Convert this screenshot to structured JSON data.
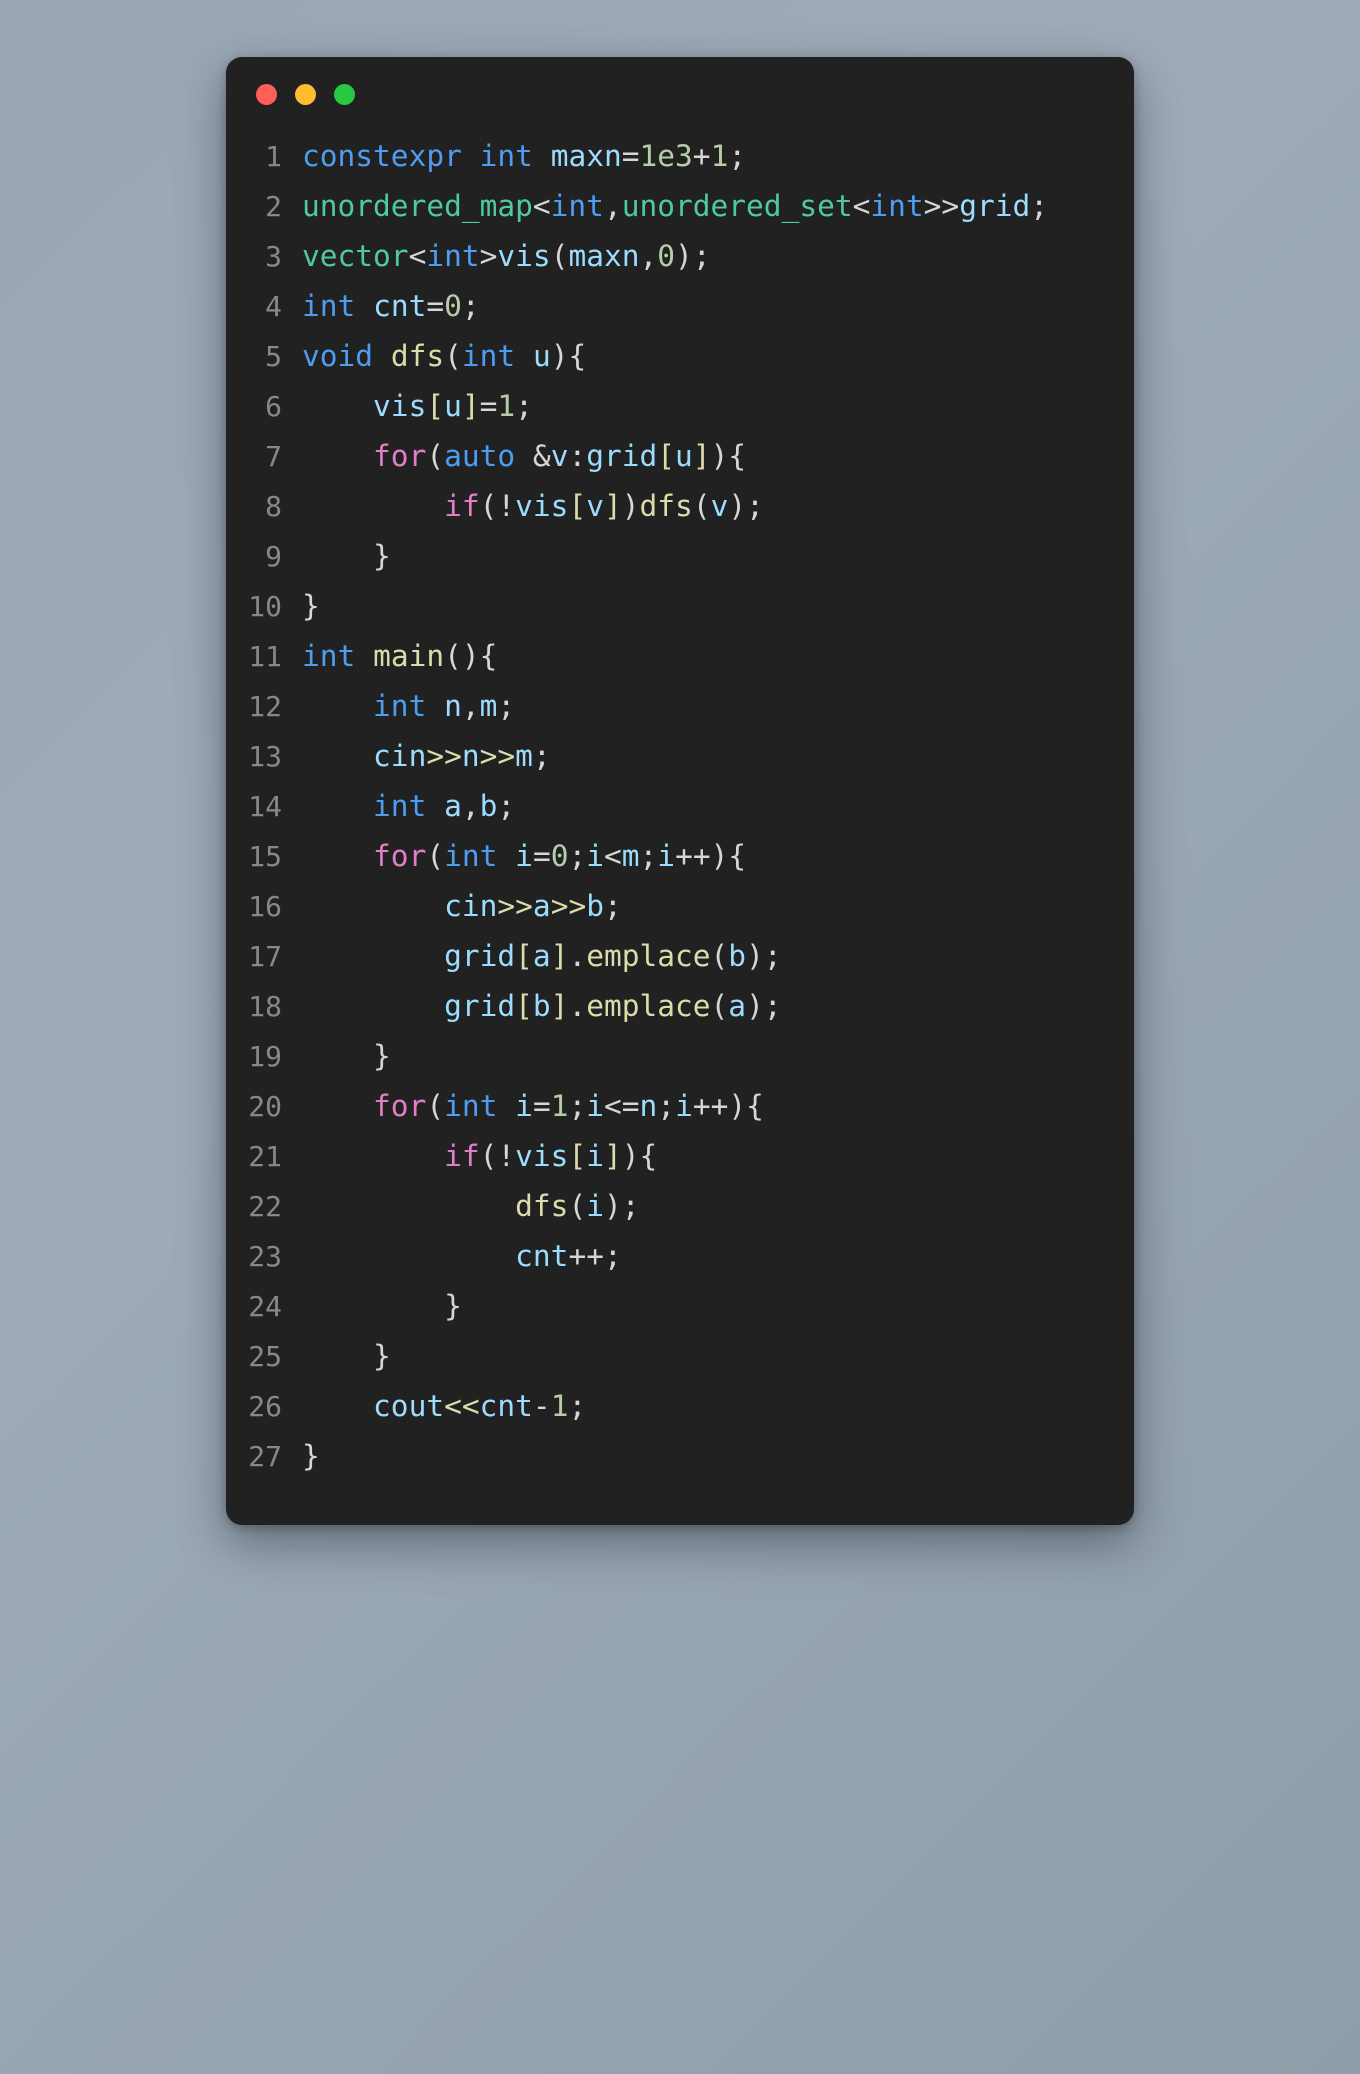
{
  "window": {
    "traffic_lights": [
      {
        "name": "close-button",
        "color": "#ff5f57"
      },
      {
        "name": "minimize-button",
        "color": "#febc2e"
      },
      {
        "name": "maximize-button",
        "color": "#28c840"
      }
    ],
    "background": "#212121",
    "page_background": "#99a5b3"
  },
  "editor": {
    "language": "cpp",
    "line_count": 27,
    "plain_code": "constexpr int maxn=1e3+1;\nunordered_map<int,unordered_set<int>>grid;\nvector<int>vis(maxn,0);\nint cnt=0;\nvoid dfs(int u){\n    vis[u]=1;\n    for(auto &v:grid[u]){\n        if(!vis[v])dfs(v);\n    }\n}\nint main(){\n    int n,m;\n    cin>>n>>m;\n    int a,b;\n    for(int i=0;i<m;i++){\n        cin>>a>>b;\n        grid[a].emplace(b);\n        grid[b].emplace(a);\n    }\n    for(int i=1;i<=n;i++){\n        if(!vis[i]){\n            dfs(i);\n            cnt++;\n        }\n    }\n    cout<<cnt-1;\n}",
    "theme_colors": {
      "keyword": "#4d9df0",
      "control": "#e07ec8",
      "type": "#4ec9a0",
      "variable": "#9cdcfe",
      "function": "#dcdcaa",
      "bracket": "#dcdcaa",
      "number": "#b5cea8",
      "operator": "#d6d6d6",
      "line_number": "#888888"
    },
    "lines": [
      {
        "n": "1",
        "tokens": [
          {
            "t": "constexpr",
            "c": "kw"
          },
          {
            "t": " ",
            "c": "op"
          },
          {
            "t": "int",
            "c": "kw"
          },
          {
            "t": " ",
            "c": "op"
          },
          {
            "t": "maxn",
            "c": "var"
          },
          {
            "t": "=",
            "c": "op"
          },
          {
            "t": "1e3",
            "c": "num"
          },
          {
            "t": "+",
            "c": "op"
          },
          {
            "t": "1",
            "c": "num"
          },
          {
            "t": ";",
            "c": "op"
          }
        ]
      },
      {
        "n": "2",
        "tokens": [
          {
            "t": "unordered_map",
            "c": "type"
          },
          {
            "t": "<",
            "c": "op"
          },
          {
            "t": "int",
            "c": "kw"
          },
          {
            "t": ",",
            "c": "op"
          },
          {
            "t": "unordered_set",
            "c": "type"
          },
          {
            "t": "<",
            "c": "op"
          },
          {
            "t": "int",
            "c": "kw"
          },
          {
            "t": ">>",
            "c": "op"
          },
          {
            "t": "grid",
            "c": "var"
          },
          {
            "t": ";",
            "c": "op"
          }
        ]
      },
      {
        "n": "3",
        "tokens": [
          {
            "t": "vector",
            "c": "type"
          },
          {
            "t": "<",
            "c": "op"
          },
          {
            "t": "int",
            "c": "kw"
          },
          {
            "t": ">",
            "c": "op"
          },
          {
            "t": "vis",
            "c": "var"
          },
          {
            "t": "(",
            "c": "op"
          },
          {
            "t": "maxn",
            "c": "var"
          },
          {
            "t": ",",
            "c": "op"
          },
          {
            "t": "0",
            "c": "num"
          },
          {
            "t": ")",
            "c": "op"
          },
          {
            "t": ";",
            "c": "op"
          }
        ]
      },
      {
        "n": "4",
        "tokens": [
          {
            "t": "int",
            "c": "kw"
          },
          {
            "t": " ",
            "c": "op"
          },
          {
            "t": "cnt",
            "c": "var"
          },
          {
            "t": "=",
            "c": "op"
          },
          {
            "t": "0",
            "c": "num"
          },
          {
            "t": ";",
            "c": "op"
          }
        ]
      },
      {
        "n": "5",
        "tokens": [
          {
            "t": "void",
            "c": "kw"
          },
          {
            "t": " ",
            "c": "op"
          },
          {
            "t": "dfs",
            "c": "fn"
          },
          {
            "t": "(",
            "c": "op"
          },
          {
            "t": "int",
            "c": "kw"
          },
          {
            "t": " ",
            "c": "op"
          },
          {
            "t": "u",
            "c": "var"
          },
          {
            "t": "){",
            "c": "op"
          }
        ]
      },
      {
        "n": "6",
        "tokens": [
          {
            "t": "    ",
            "c": "op"
          },
          {
            "t": "vis",
            "c": "var"
          },
          {
            "t": "[",
            "c": "br"
          },
          {
            "t": "u",
            "c": "var"
          },
          {
            "t": "]",
            "c": "br"
          },
          {
            "t": "=",
            "c": "op"
          },
          {
            "t": "1",
            "c": "num"
          },
          {
            "t": ";",
            "c": "op"
          }
        ]
      },
      {
        "n": "7",
        "tokens": [
          {
            "t": "    ",
            "c": "op"
          },
          {
            "t": "for",
            "c": "ctl"
          },
          {
            "t": "(",
            "c": "op"
          },
          {
            "t": "auto",
            "c": "kw"
          },
          {
            "t": " &",
            "c": "op"
          },
          {
            "t": "v",
            "c": "var"
          },
          {
            "t": ":",
            "c": "op"
          },
          {
            "t": "grid",
            "c": "var"
          },
          {
            "t": "[",
            "c": "br"
          },
          {
            "t": "u",
            "c": "var"
          },
          {
            "t": "]",
            "c": "br"
          },
          {
            "t": "){",
            "c": "op"
          }
        ]
      },
      {
        "n": "8",
        "tokens": [
          {
            "t": "        ",
            "c": "op"
          },
          {
            "t": "if",
            "c": "ctl"
          },
          {
            "t": "(!",
            "c": "op"
          },
          {
            "t": "vis",
            "c": "var"
          },
          {
            "t": "[",
            "c": "br"
          },
          {
            "t": "v",
            "c": "var"
          },
          {
            "t": "]",
            "c": "br"
          },
          {
            "t": ")",
            "c": "op"
          },
          {
            "t": "dfs",
            "c": "fn"
          },
          {
            "t": "(",
            "c": "op"
          },
          {
            "t": "v",
            "c": "var"
          },
          {
            "t": ");",
            "c": "op"
          }
        ]
      },
      {
        "n": "9",
        "tokens": [
          {
            "t": "    }",
            "c": "op"
          }
        ]
      },
      {
        "n": "10",
        "tokens": [
          {
            "t": "}",
            "c": "op"
          }
        ]
      },
      {
        "n": "11",
        "tokens": [
          {
            "t": "int",
            "c": "kw"
          },
          {
            "t": " ",
            "c": "op"
          },
          {
            "t": "main",
            "c": "fn"
          },
          {
            "t": "(){",
            "c": "op"
          }
        ]
      },
      {
        "n": "12",
        "tokens": [
          {
            "t": "    ",
            "c": "op"
          },
          {
            "t": "int",
            "c": "kw"
          },
          {
            "t": " ",
            "c": "op"
          },
          {
            "t": "n",
            "c": "var"
          },
          {
            "t": ",",
            "c": "op"
          },
          {
            "t": "m",
            "c": "var"
          },
          {
            "t": ";",
            "c": "op"
          }
        ]
      },
      {
        "n": "13",
        "tokens": [
          {
            "t": "    ",
            "c": "op"
          },
          {
            "t": "cin",
            "c": "var"
          },
          {
            "t": ">>",
            "c": "br"
          },
          {
            "t": "n",
            "c": "var"
          },
          {
            "t": ">>",
            "c": "br"
          },
          {
            "t": "m",
            "c": "var"
          },
          {
            "t": ";",
            "c": "op"
          }
        ]
      },
      {
        "n": "14",
        "tokens": [
          {
            "t": "    ",
            "c": "op"
          },
          {
            "t": "int",
            "c": "kw"
          },
          {
            "t": " ",
            "c": "op"
          },
          {
            "t": "a",
            "c": "var"
          },
          {
            "t": ",",
            "c": "op"
          },
          {
            "t": "b",
            "c": "var"
          },
          {
            "t": ";",
            "c": "op"
          }
        ]
      },
      {
        "n": "15",
        "tokens": [
          {
            "t": "    ",
            "c": "op"
          },
          {
            "t": "for",
            "c": "ctl"
          },
          {
            "t": "(",
            "c": "op"
          },
          {
            "t": "int",
            "c": "kw"
          },
          {
            "t": " ",
            "c": "op"
          },
          {
            "t": "i",
            "c": "var"
          },
          {
            "t": "=",
            "c": "op"
          },
          {
            "t": "0",
            "c": "num"
          },
          {
            "t": ";",
            "c": "op"
          },
          {
            "t": "i",
            "c": "var"
          },
          {
            "t": "<",
            "c": "op"
          },
          {
            "t": "m",
            "c": "var"
          },
          {
            "t": ";",
            "c": "op"
          },
          {
            "t": "i",
            "c": "var"
          },
          {
            "t": "++){",
            "c": "op"
          }
        ]
      },
      {
        "n": "16",
        "tokens": [
          {
            "t": "        ",
            "c": "op"
          },
          {
            "t": "cin",
            "c": "var"
          },
          {
            "t": ">>",
            "c": "br"
          },
          {
            "t": "a",
            "c": "var"
          },
          {
            "t": ">>",
            "c": "br"
          },
          {
            "t": "b",
            "c": "var"
          },
          {
            "t": ";",
            "c": "op"
          }
        ]
      },
      {
        "n": "17",
        "tokens": [
          {
            "t": "        ",
            "c": "op"
          },
          {
            "t": "grid",
            "c": "var"
          },
          {
            "t": "[",
            "c": "br"
          },
          {
            "t": "a",
            "c": "var"
          },
          {
            "t": "]",
            "c": "br"
          },
          {
            "t": ".",
            "c": "op"
          },
          {
            "t": "emplace",
            "c": "fn"
          },
          {
            "t": "(",
            "c": "op"
          },
          {
            "t": "b",
            "c": "var"
          },
          {
            "t": ");",
            "c": "op"
          }
        ]
      },
      {
        "n": "18",
        "tokens": [
          {
            "t": "        ",
            "c": "op"
          },
          {
            "t": "grid",
            "c": "var"
          },
          {
            "t": "[",
            "c": "br"
          },
          {
            "t": "b",
            "c": "var"
          },
          {
            "t": "]",
            "c": "br"
          },
          {
            "t": ".",
            "c": "op"
          },
          {
            "t": "emplace",
            "c": "fn"
          },
          {
            "t": "(",
            "c": "op"
          },
          {
            "t": "a",
            "c": "var"
          },
          {
            "t": ");",
            "c": "op"
          }
        ]
      },
      {
        "n": "19",
        "tokens": [
          {
            "t": "    }",
            "c": "op"
          }
        ]
      },
      {
        "n": "20",
        "tokens": [
          {
            "t": "    ",
            "c": "op"
          },
          {
            "t": "for",
            "c": "ctl"
          },
          {
            "t": "(",
            "c": "op"
          },
          {
            "t": "int",
            "c": "kw"
          },
          {
            "t": " ",
            "c": "op"
          },
          {
            "t": "i",
            "c": "var"
          },
          {
            "t": "=",
            "c": "op"
          },
          {
            "t": "1",
            "c": "num"
          },
          {
            "t": ";",
            "c": "op"
          },
          {
            "t": "i",
            "c": "var"
          },
          {
            "t": "<=",
            "c": "op"
          },
          {
            "t": "n",
            "c": "var"
          },
          {
            "t": ";",
            "c": "op"
          },
          {
            "t": "i",
            "c": "var"
          },
          {
            "t": "++){",
            "c": "op"
          }
        ]
      },
      {
        "n": "21",
        "tokens": [
          {
            "t": "        ",
            "c": "op"
          },
          {
            "t": "if",
            "c": "ctl"
          },
          {
            "t": "(!",
            "c": "op"
          },
          {
            "t": "vis",
            "c": "var"
          },
          {
            "t": "[",
            "c": "br"
          },
          {
            "t": "i",
            "c": "var"
          },
          {
            "t": "]",
            "c": "br"
          },
          {
            "t": "){",
            "c": "op"
          }
        ]
      },
      {
        "n": "22",
        "tokens": [
          {
            "t": "            ",
            "c": "op"
          },
          {
            "t": "dfs",
            "c": "fn"
          },
          {
            "t": "(",
            "c": "op"
          },
          {
            "t": "i",
            "c": "var"
          },
          {
            "t": ");",
            "c": "op"
          }
        ]
      },
      {
        "n": "23",
        "tokens": [
          {
            "t": "            ",
            "c": "op"
          },
          {
            "t": "cnt",
            "c": "var"
          },
          {
            "t": "++;",
            "c": "op"
          }
        ]
      },
      {
        "n": "24",
        "tokens": [
          {
            "t": "        }",
            "c": "op"
          }
        ]
      },
      {
        "n": "25",
        "tokens": [
          {
            "t": "    }",
            "c": "op"
          }
        ]
      },
      {
        "n": "26",
        "tokens": [
          {
            "t": "    ",
            "c": "op"
          },
          {
            "t": "cout",
            "c": "var"
          },
          {
            "t": "<<",
            "c": "br"
          },
          {
            "t": "cnt",
            "c": "var"
          },
          {
            "t": "-",
            "c": "op"
          },
          {
            "t": "1",
            "c": "num"
          },
          {
            "t": ";",
            "c": "op"
          }
        ]
      },
      {
        "n": "27",
        "tokens": [
          {
            "t": "}",
            "c": "op"
          }
        ]
      }
    ]
  }
}
